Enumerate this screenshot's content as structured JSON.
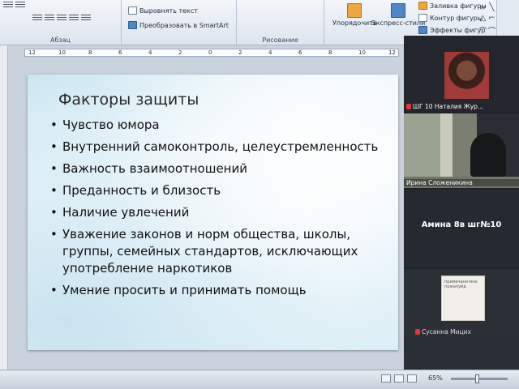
{
  "ribbon": {
    "paragraph_group_label": "Абзац",
    "drawing_group_label": "Рисование",
    "align_text_label": "Выровнять текст",
    "smartart_label": "Преобразовать в SmartArt",
    "arrange_label": "Упорядочить",
    "quick_styles_label": "Экспресс-стили",
    "shape_fill_label": "Заливка фигуры",
    "shape_outline_label": "Контур фигуры",
    "shape_effects_label": "Эффекты фигур",
    "shape_glyphs": [
      "▱",
      "╲",
      "╲",
      "▢",
      "○",
      "□",
      "△",
      "⇩",
      "△",
      "⌐",
      "Ⴂ",
      "⇨",
      "⇧",
      "☐",
      "◇",
      "▢",
      "⌒",
      "⌒",
      "{",
      "}",
      "☆"
    ]
  },
  "ruler": {
    "ticks": [
      "12",
      "10",
      "8",
      "6",
      "4",
      "2",
      "0",
      "2",
      "4",
      "6",
      "8",
      "10",
      "12"
    ]
  },
  "slide": {
    "title": "Факторы защиты",
    "bullets": [
      "Чувство юмора",
      "Внутренний самоконтроль, целеустремленность",
      "Важность взаимоотношений",
      "Преданность и близость",
      "Наличие увлечений",
      "Уважение законов и норм общества, школы, группы, семейных стандартов, исключающих употребление наркотиков",
      "Умение просить и принимать помощь"
    ]
  },
  "video": {
    "tile1_name": "ШГ 10 Наталия Жур...",
    "tile2_name": "Ирина Сложеникина",
    "tile3_name": "Амина 8в шг№10",
    "tile4_note": "примечаня мне пожалуйд",
    "tile4_name": "Сусанна Мицих"
  },
  "status": {
    "zoom": "65%"
  }
}
